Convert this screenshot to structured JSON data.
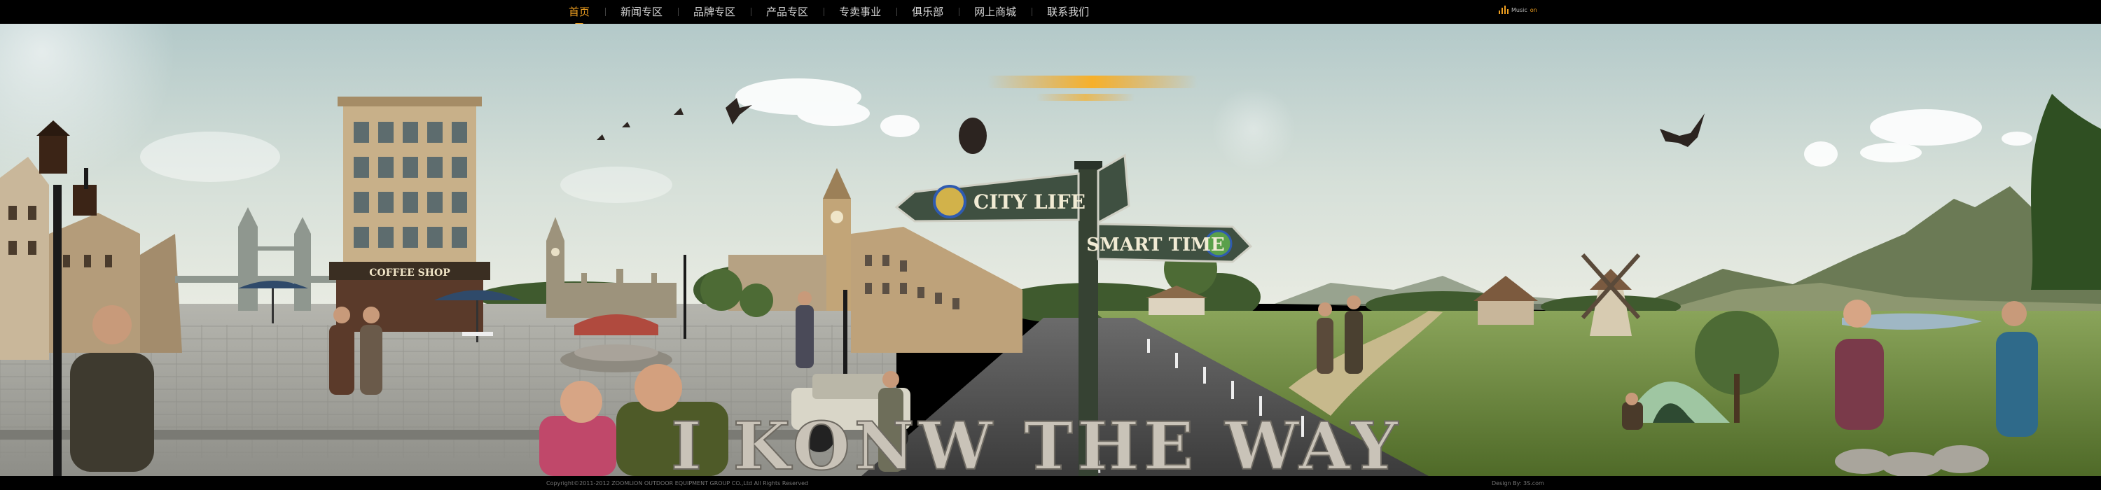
{
  "nav": {
    "items": [
      {
        "label": "首页",
        "active": true
      },
      {
        "label": "新闻专区",
        "active": false
      },
      {
        "label": "品牌专区",
        "active": false
      },
      {
        "label": "产品专区",
        "active": false
      },
      {
        "label": "专卖事业",
        "active": false
      },
      {
        "label": "俱乐部",
        "active": false
      },
      {
        "label": "网上商城",
        "active": false
      },
      {
        "label": "联系我们",
        "active": false
      }
    ]
  },
  "music": {
    "label": "Music",
    "state": "on"
  },
  "scene": {
    "coffee_shop_sign": "COFFEE SHOP",
    "sign_city": "CITY LIFE",
    "sign_smart": "SMART TIME",
    "headline": "I KONW THE WAY"
  },
  "footer": {
    "copyright": "Copyright©2011-2012 ZOOMLION OUTDOOR EQUIPMENT GROUP CO.,Ltd All Rights Reserved",
    "design": "Design By: 3S.com"
  },
  "colors": {
    "accent": "#f0a020",
    "sky_top": "#bcd0cf",
    "sky_bottom": "#e0e6dc",
    "grass": "#6d8a3c",
    "plaza": "#a7a7a2",
    "road": "#4a4a4a",
    "sign_green": "#3a4a3a"
  }
}
